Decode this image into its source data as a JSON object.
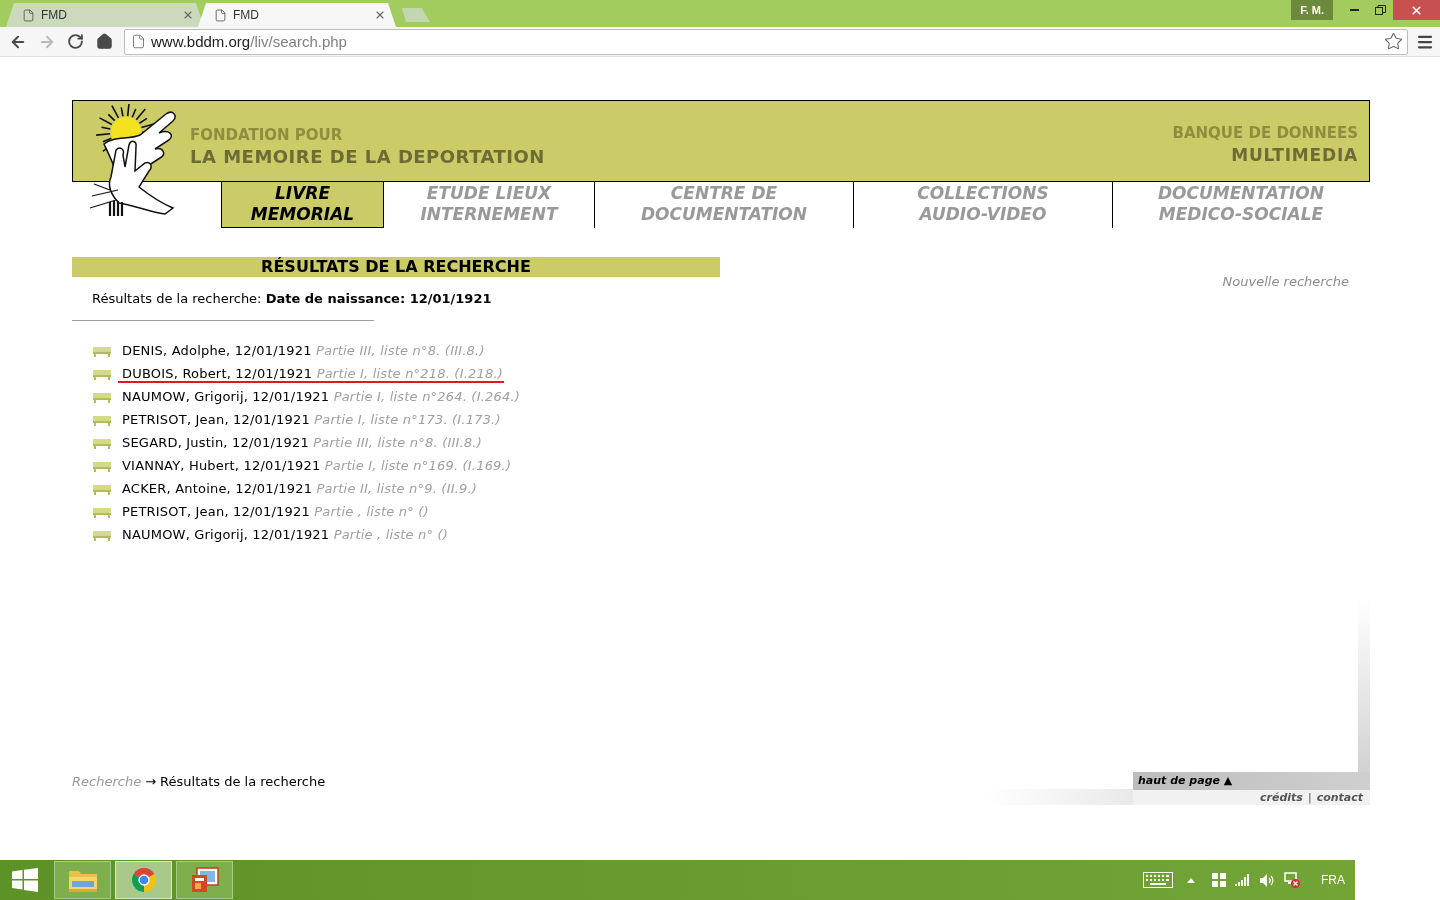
{
  "browser": {
    "tabs": [
      {
        "title": "FMD",
        "selected": false
      },
      {
        "title": "FMD",
        "selected": true
      }
    ],
    "profile_badge": "F. M.",
    "toolbar_buttons": [
      {
        "kind": "back",
        "disabled": false
      },
      {
        "kind": "forward",
        "disabled": true
      },
      {
        "kind": "reload",
        "disabled": false
      },
      {
        "kind": "home",
        "disabled": false
      }
    ],
    "address": {
      "host": "www.bddm.org",
      "path": "/liv/search.php"
    }
  },
  "site_header": {
    "org_line_1": "FONDATION POUR",
    "org_line_2": "LA MEMOIRE DE LA DEPORTATION",
    "db_line_1": "BANQUE DE DONNEES",
    "db_line_2": "MULTIMEDIA"
  },
  "nav": [
    {
      "lines": [
        "LIVRE",
        "MEMORIAL"
      ],
      "selected": true
    },
    {
      "lines": [
        "ETUDE LIEUX",
        "INTERNEMENT"
      ],
      "selected": false
    },
    {
      "lines": [
        "CENTRE DE",
        "DOCUMENTATION"
      ],
      "selected": false
    },
    {
      "lines": [
        "COLLECTIONS",
        "AUDIO-VIDEO"
      ],
      "selected": false
    },
    {
      "lines": [
        "DOCUMENTATION",
        "MEDICO-SOCIALE"
      ],
      "selected": false
    }
  ],
  "results": {
    "heading": "RÉSULTATS DE LA RECHERCHE",
    "summary_label": "Résultats de la recherche:",
    "summary_value": "Date de naissance: 12/01/1921",
    "new_search": "Nouvelle recherche",
    "items": [
      {
        "person": "DENIS, Adolphe, 12/01/1921",
        "reference": "Partie III, liste n°8. (III.8.)",
        "underlined": false
      },
      {
        "person": "DUBOIS, Robert, 12/01/1921",
        "reference": "Partie I, liste n°218. (I.218.)",
        "underlined": true
      },
      {
        "person": "NAUMOW, Grigorij, 12/01/1921",
        "reference": "Partie I, liste n°264. (I.264.)",
        "underlined": false
      },
      {
        "person": "PETRISOT, Jean, 12/01/1921",
        "reference": "Partie I, liste n°173. (I.173.)",
        "underlined": false
      },
      {
        "person": "SEGARD, Justin, 12/01/1921",
        "reference": "Partie III, liste n°8. (III.8.)",
        "underlined": false
      },
      {
        "person": "VIANNAY, Hubert, 12/01/1921",
        "reference": "Partie I, liste n°169. (I.169.)",
        "underlined": false
      },
      {
        "person": "ACKER, Antoine, 12/01/1921",
        "reference": "Partie II, liste n°9. (II.9.)",
        "underlined": false
      },
      {
        "person": "PETRISOT, Jean, 12/01/1921",
        "reference": "Partie , liste n° ()",
        "underlined": false
      },
      {
        "person": "NAUMOW, Grigorij, 12/01/1921",
        "reference": "Partie , liste n° ()",
        "underlined": false
      }
    ]
  },
  "breadcrumb": {
    "items": [
      {
        "label": "Recherche",
        "current": false
      },
      {
        "label": "Résultats de la recherche",
        "current": true
      }
    ],
    "separator": "→"
  },
  "footer": {
    "top_link": "haut de page ▲",
    "links": [
      "crédits",
      "contact"
    ],
    "separator": "|"
  },
  "taskbar": {
    "apps": [
      {
        "kind": "file-explorer",
        "selected": false
      },
      {
        "kind": "browser",
        "selected": true
      },
      {
        "kind": "presentation",
        "selected": false
      }
    ],
    "language": "FRA"
  }
}
